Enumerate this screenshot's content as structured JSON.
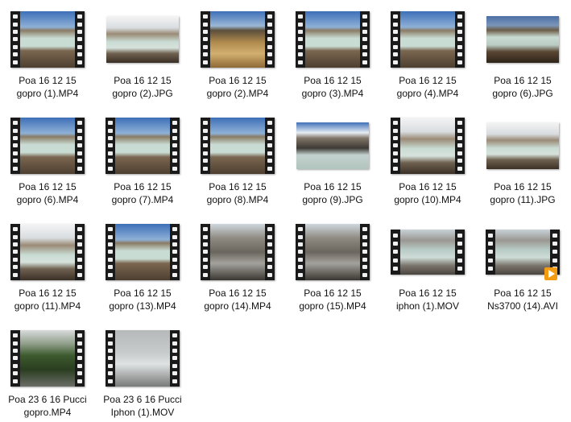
{
  "files": [
    {
      "line1": "Poa 16 12 15",
      "line2": "gopro (1).MP4",
      "kind": "video",
      "scene": "lake"
    },
    {
      "line1": "Poa 16 12 15",
      "line2": "gopro (2).JPG",
      "kind": "photo",
      "scene": "steam"
    },
    {
      "line1": "Poa 16 12 15",
      "line2": "gopro (2).MP4",
      "kind": "video",
      "scene": "brown"
    },
    {
      "line1": "Poa 16 12 15",
      "line2": "gopro (3).MP4",
      "kind": "video",
      "scene": "lake"
    },
    {
      "line1": "Poa 16 12 15",
      "line2": "gopro (4).MP4",
      "kind": "video",
      "scene": "lake"
    },
    {
      "line1": "Poa 16 12 15",
      "line2": "gopro (6).JPG",
      "kind": "photo",
      "scene": "rocks"
    },
    {
      "line1": "Poa 16 12 15",
      "line2": "gopro (6).MP4",
      "kind": "video",
      "scene": "lake"
    },
    {
      "line1": "Poa 16 12 15",
      "line2": "gopro (7).MP4",
      "kind": "video",
      "scene": "lake"
    },
    {
      "line1": "Poa 16 12 15",
      "line2": "gopro (8).MP4",
      "kind": "video",
      "scene": "lake"
    },
    {
      "line1": "Poa 16 12 15",
      "line2": "gopro (9).JPG",
      "kind": "photo",
      "scene": "cliff"
    },
    {
      "line1": "Poa 16 12 15",
      "line2": "gopro (10).MP4",
      "kind": "video",
      "scene": "steam"
    },
    {
      "line1": "Poa 16 12 15",
      "line2": "gopro (11).JPG",
      "kind": "photo",
      "scene": "steam"
    },
    {
      "line1": "Poa 16 12 15",
      "line2": "gopro (11).MP4",
      "kind": "video",
      "scene": "steam"
    },
    {
      "line1": "Poa 16 12 15",
      "line2": "gopro (13).MP4",
      "kind": "video",
      "scene": "lake"
    },
    {
      "line1": "Poa 16 12 15",
      "line2": "gopro (14).MP4",
      "kind": "video",
      "scene": "gully"
    },
    {
      "line1": "Poa 16 12 15",
      "line2": "gopro (15).MP4",
      "kind": "video",
      "scene": "gully"
    },
    {
      "line1": "Poa 16 12 15",
      "line2": "iphon (1).MOV",
      "kind": "video-short",
      "scene": "grey"
    },
    {
      "line1": "Poa 16 12 15",
      "line2": "Ns3700 (14).AVI",
      "kind": "video-short",
      "scene": "grey",
      "badge": "vlc"
    },
    {
      "line1": "Poa 23 6 16 Pucci",
      "line2": "gopro.MP4",
      "kind": "video",
      "scene": "forest"
    },
    {
      "line1": "Poa 23 6 16 Pucci",
      "line2": "Iphon (1).MOV",
      "kind": "video",
      "scene": "fog"
    }
  ],
  "colors": {
    "sky": "#3d6fb8",
    "lake": "#c9dcd4",
    "rock": "#7a6650",
    "brown": "#b08a4e",
    "green": "#3c5a2e",
    "fog": "#c8cbcc"
  }
}
